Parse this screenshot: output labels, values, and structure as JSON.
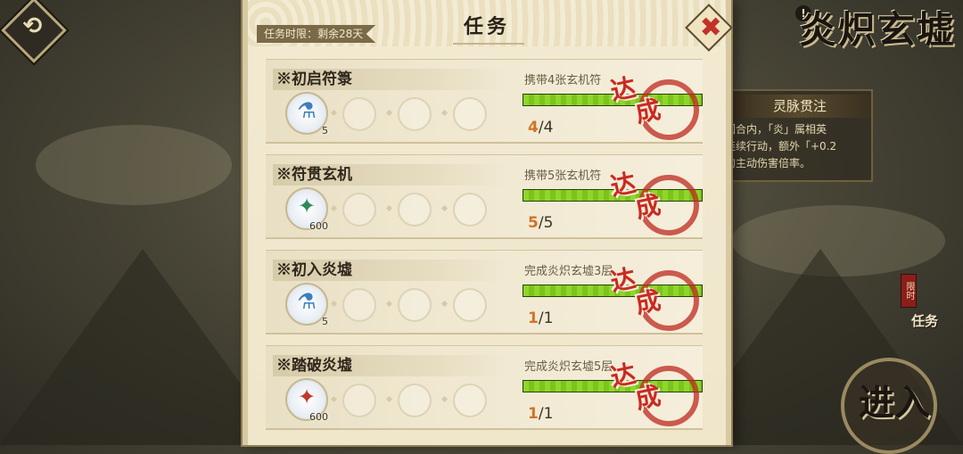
{
  "header": {
    "back_icon": "back-arrow-icon",
    "back_glyph": "⟲",
    "game_title": "炎炽玄墟",
    "info_glyph": "!"
  },
  "side_panel": {
    "title": "灵脉贯注",
    "lines": [
      "回合内，「炎」属相英",
      "连续行动，额外「+0.2",
      "的主动伤害倍率。"
    ]
  },
  "side_task_button": {
    "flag": "限时",
    "label": "任务"
  },
  "enter_button": {
    "label": "进入"
  },
  "task_panel": {
    "title": "任务",
    "deadline": "任务时限：剩余28天",
    "close_glyph": "✖",
    "stamp": [
      "达",
      "成"
    ],
    "tasks": [
      {
        "name": "※初启符箓",
        "objective": "携带4张玄机符",
        "reward_icon": "potion-bottle-icon",
        "reward_glyph": "⚗",
        "reward_count": "5",
        "current": "4",
        "total": "/4",
        "progress": 1.0
      },
      {
        "name": "※符贯玄机",
        "objective": "携带5张玄机符",
        "reward_icon": "jade-coin-icon",
        "reward_glyph": "✦",
        "reward_count": "600",
        "current": "5",
        "total": "/5",
        "progress": 1.0
      },
      {
        "name": "※初入炎墟",
        "objective": "完成炎炽玄墟3层",
        "reward_icon": "potion-bottle-icon",
        "reward_glyph": "⚗",
        "reward_count": "5",
        "current": "1",
        "total": "/1",
        "progress": 1.0
      },
      {
        "name": "※踏破炎墟",
        "objective": "完成炎炽玄墟5层",
        "reward_icon": "red-coin-icon",
        "reward_glyph": "✦",
        "reward_count": "600",
        "current": "1",
        "total": "/1",
        "progress": 1.0
      }
    ]
  }
}
